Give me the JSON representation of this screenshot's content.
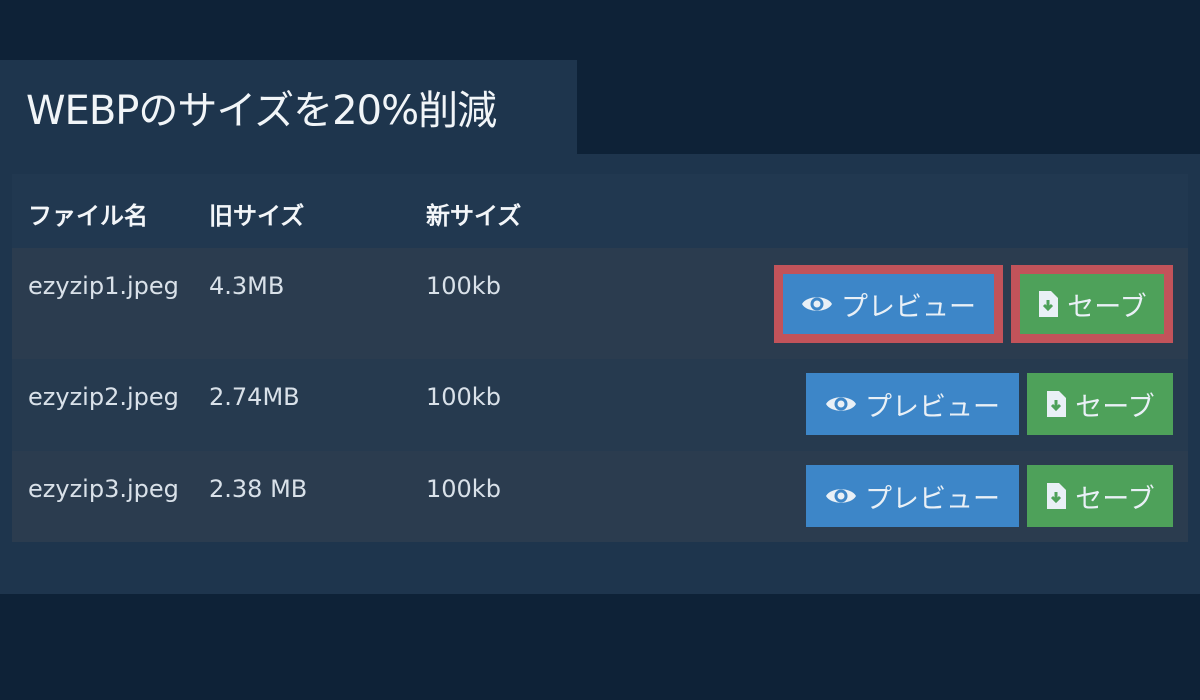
{
  "title": "WEBPのサイズを20%削減",
  "table": {
    "headers": [
      "ファイル名",
      "旧サイズ",
      "新サイズ"
    ],
    "rows": [
      {
        "name": "ezyzip1.jpeg",
        "old_size": "4.3MB",
        "new_size": "100kb",
        "preview_label": "プレビュー",
        "save_label": "セーブ"
      },
      {
        "name": "ezyzip2.jpeg",
        "old_size": "2.74MB",
        "new_size": "100kb",
        "preview_label": "プレビュー",
        "save_label": "セーブ"
      },
      {
        "name": "ezyzip3.jpeg",
        "old_size": "2.38 MB",
        "new_size": "100kb",
        "preview_label": "プレビュー",
        "save_label": "セーブ"
      }
    ]
  },
  "icons": {
    "preview": "eye-icon",
    "save": "file-download-icon"
  },
  "colors": {
    "background": "#0e2237",
    "panel": "#1e354d",
    "preview_button": "#3d86c8",
    "save_button": "#4ea15a",
    "highlight": "#c2535a"
  }
}
